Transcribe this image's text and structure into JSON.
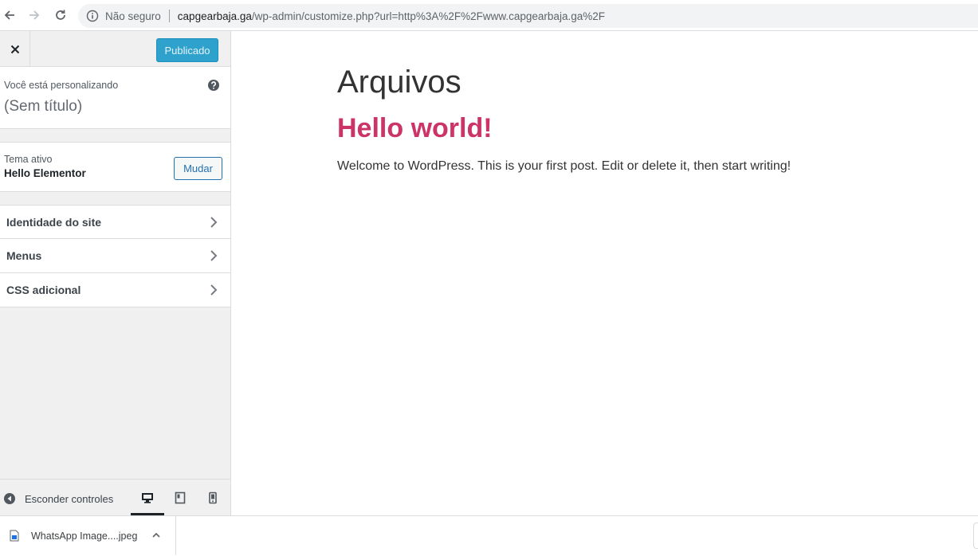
{
  "browser": {
    "security_label": "Não seguro",
    "url_domain": "capgearbaja.ga",
    "url_path": "/wp-admin/customize.php?url=http%3A%2F%2Fwww.capgearbaja.ga%2F",
    "icons": [
      "back-arrow-icon",
      "forward-arrow-icon",
      "reload-icon",
      "info-icon"
    ]
  },
  "customizer": {
    "publish_label": "Publicado",
    "info": {
      "label": "Você está personalizando",
      "site_title": "(Sem título)"
    },
    "theme": {
      "label": "Tema ativo",
      "name": "Hello Elementor",
      "change_label": "Mudar"
    },
    "panels": [
      {
        "label": "Identidade do site"
      },
      {
        "label": "Menus"
      },
      {
        "label": "CSS adicional"
      }
    ],
    "footer": {
      "collapse_label": "Esconder controles",
      "devices": [
        "desktop",
        "tablet",
        "mobile"
      ],
      "active_device": "desktop"
    }
  },
  "preview": {
    "archive_title": "Arquivos",
    "post_title": "Hello world!",
    "post_excerpt": "Welcome to WordPress. This is your first post. Edit or delete it, then start writing!"
  },
  "downloads": {
    "items": [
      {
        "file_name": "WhatsApp Image....jpeg"
      }
    ]
  },
  "colors": {
    "publish_button": "#2ea2cc",
    "post_title": "#cc3366",
    "link_accent": "#2271b1"
  }
}
